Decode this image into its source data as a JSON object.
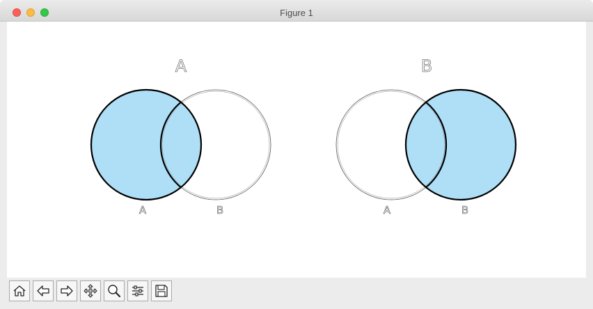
{
  "window": {
    "title": "Figure 1"
  },
  "figure": {
    "panels": [
      {
        "title": "A",
        "left_label": "A",
        "right_label": "B",
        "highlighted_set": "A"
      },
      {
        "title": "B",
        "left_label": "A",
        "right_label": "B",
        "highlighted_set": "B"
      }
    ],
    "colors": {
      "highlight_fill": "#aedff7",
      "circle_outline": "#000000",
      "unhighlighted_outline": "#555555"
    }
  },
  "toolbar": {
    "buttons": [
      {
        "name": "home-button",
        "icon": "home-icon"
      },
      {
        "name": "back-button",
        "icon": "back-arrow-icon"
      },
      {
        "name": "forward-button",
        "icon": "forward-arrow-icon"
      },
      {
        "name": "pan-button",
        "icon": "move-arrows-icon"
      },
      {
        "name": "zoom-button",
        "icon": "magnifier-icon"
      },
      {
        "name": "configure-subplots-button",
        "icon": "sliders-icon"
      },
      {
        "name": "save-button",
        "icon": "floppy-disk-icon"
      }
    ]
  }
}
